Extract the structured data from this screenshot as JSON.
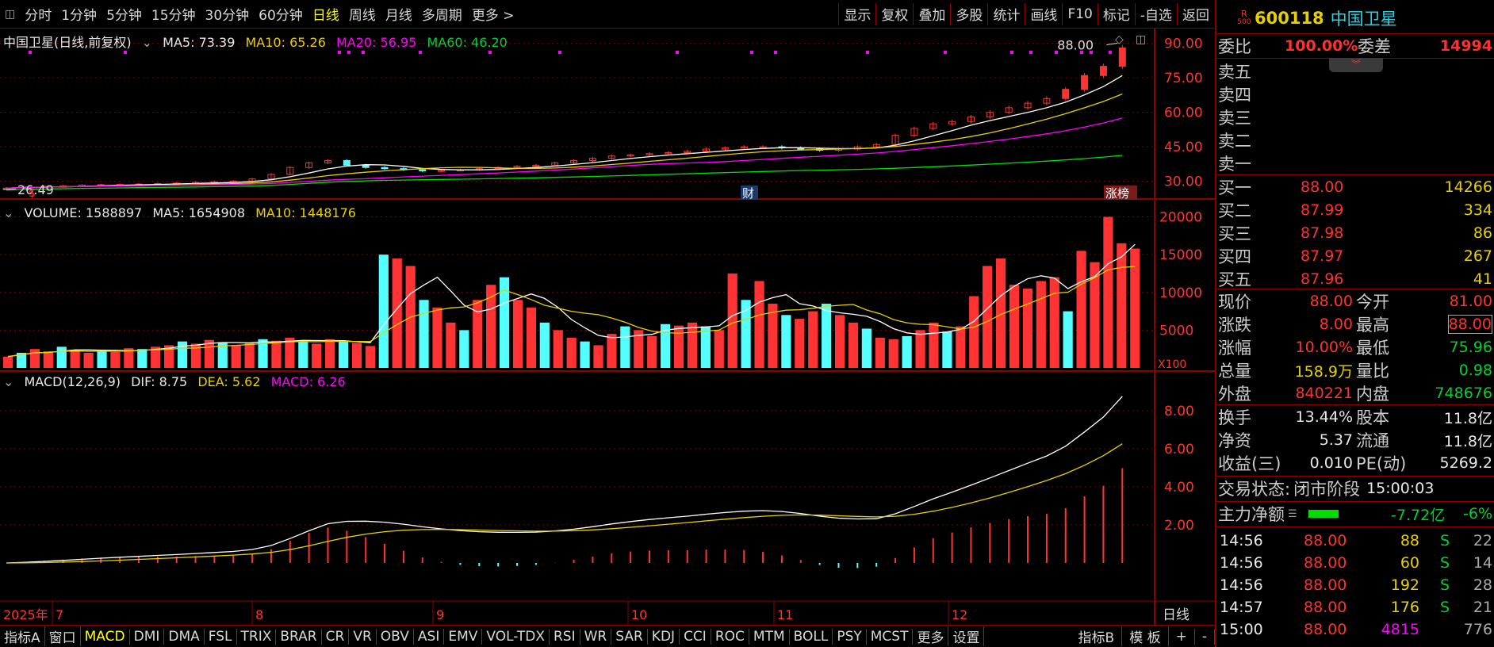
{
  "top_toolbar": {
    "left_items": [
      "分时",
      "1分钟",
      "5分钟",
      "15分钟",
      "30分钟",
      "60分钟",
      "日线",
      "周线",
      "月线",
      "多周期",
      "更多 >"
    ],
    "active": "日线",
    "right_items": [
      "显示",
      "复权",
      "叠加",
      "多股",
      "统计",
      "画线",
      "F10",
      "标记",
      "-自选",
      "返回"
    ]
  },
  "kline": {
    "title": "中国卫星(日线,前复权)",
    "ma5": "MA5: 73.39",
    "ma10": "MA10: 65.26",
    "ma20": "MA20: 56.95",
    "ma60": "MA60: 46.20",
    "price_ticks": [
      "90.00",
      "75.00",
      "60.00",
      "45.00",
      "30.00"
    ],
    "high_label": "88.00",
    "low_label": "26.49",
    "marker_cai": "财",
    "marker_zhangbang": "涨榜"
  },
  "volume": {
    "title": "VOLUME: 1588897",
    "ma5": "MA5: 1654908",
    "ma10": "MA10: 1448176",
    "ticks": [
      "20000",
      "15000",
      "10000",
      "5000"
    ],
    "unit": "X100"
  },
  "macd": {
    "title": "MACD(12,26,9)",
    "dif": "DIF: 8.75",
    "dea": "DEA: 5.62",
    "macd": "MACD: 6.26",
    "ticks": [
      "8.00",
      "6.00",
      "4.00",
      "2.00"
    ]
  },
  "time_axis": {
    "labels": [
      "2025年",
      "7",
      "8",
      "9",
      "10",
      "11",
      "12"
    ],
    "period": "日线"
  },
  "colors": {
    "up": "#ff3333",
    "down": "#54ffff",
    "ma5": "#ffffff",
    "ma10": "#e8d000",
    "ma20": "#ff00ff",
    "ma60": "#00e000",
    "frame": "#8b0000"
  },
  "chart_data": [
    {
      "type": "candlestick",
      "title": "中国卫星(日线,前复权)",
      "y_range": [
        24,
        93
      ],
      "x_labels": [
        "7",
        "8",
        "9",
        "10",
        "11",
        "12"
      ],
      "close_approx": [
        27,
        27.5,
        27.8,
        28,
        28.3,
        28.5,
        28.6,
        28.8,
        29,
        29.2,
        29.5,
        29.8,
        30,
        31,
        33,
        36,
        38,
        39,
        37,
        36,
        35.5,
        35,
        34.5,
        34.8,
        35,
        35.5,
        36,
        36.5,
        37,
        38,
        39,
        40,
        41,
        41.5,
        42,
        42.5,
        43,
        44,
        44.5,
        45,
        45,
        44.5,
        44,
        43.5,
        44,
        45,
        46,
        50,
        53,
        55,
        56,
        58,
        60,
        62,
        64,
        66,
        70,
        76,
        80,
        88
      ],
      "series": [
        {
          "name": "MA5",
          "last": 73.39
        },
        {
          "name": "MA10",
          "last": 65.26
        },
        {
          "name": "MA20",
          "last": 56.95
        },
        {
          "name": "MA60",
          "last": 46.2
        }
      ]
    },
    {
      "type": "bar",
      "title": "VOLUME",
      "unit": "X100",
      "y_range": [
        0,
        21000
      ],
      "values": [
        1500,
        2000,
        2500,
        2200,
        2800,
        2400,
        2000,
        2300,
        2100,
        2600,
        2500,
        2800,
        3000,
        3500,
        3200,
        3700,
        3400,
        3000,
        3300,
        3800,
        3600,
        4000,
        3500,
        3200,
        3800,
        3500,
        3300,
        2900,
        15000,
        14500,
        13500,
        9000,
        8000,
        6000,
        5000,
        9000,
        11000,
        12000,
        9000,
        8000,
        6000,
        5000,
        4000,
        3500,
        3000,
        4500,
        5500,
        5000,
        4200,
        5800,
        5600,
        6000,
        5500,
        5000,
        12500,
        9000,
        11500,
        8500,
        7000,
        6500,
        7500,
        8500,
        7000,
        6000,
        5200,
        4000,
        3800,
        4200,
        5000,
        6000,
        4800,
        5500,
        9500,
        13500,
        14500,
        11000,
        10500,
        11500,
        12000,
        7500,
        15500,
        14000,
        20000,
        16500,
        15800
      ],
      "series": [
        {
          "name": "MA5",
          "last": 1654908
        },
        {
          "name": "MA10",
          "last": 1448176
        }
      ]
    },
    {
      "type": "line",
      "title": "MACD(12,26,9)",
      "y_range": [
        -1.5,
        9.5
      ],
      "series": [
        {
          "name": "DIF",
          "last": 8.75
        },
        {
          "name": "DEA",
          "last": 5.62
        },
        {
          "name": "MACD",
          "last": 6.26
        }
      ]
    }
  ],
  "quote": {
    "code": "600118",
    "name": "中国卫星",
    "badge_top": "R",
    "badge_bottom": "500",
    "weibi_label": "委比",
    "weibi_value": "100.00%",
    "weicha_label": "委差",
    "weicha_value": "14994",
    "sell": [
      {
        "label": "卖五",
        "price": "",
        "vol": ""
      },
      {
        "label": "卖四",
        "price": "",
        "vol": ""
      },
      {
        "label": "卖三",
        "price": "",
        "vol": ""
      },
      {
        "label": "卖二",
        "price": "",
        "vol": ""
      },
      {
        "label": "卖一",
        "price": "",
        "vol": ""
      }
    ],
    "buy": [
      {
        "label": "买一",
        "price": "88.00",
        "vol": "14266"
      },
      {
        "label": "买二",
        "price": "87.99",
        "vol": "334"
      },
      {
        "label": "买三",
        "price": "87.98",
        "vol": "86"
      },
      {
        "label": "买四",
        "price": "87.97",
        "vol": "267"
      },
      {
        "label": "买五",
        "price": "87.96",
        "vol": "41"
      }
    ],
    "stats": [
      {
        "l1": "现价",
        "v1": "88.00",
        "c1": "red",
        "l2": "今开",
        "v2": "81.00",
        "c2": "red"
      },
      {
        "l1": "涨跌",
        "v1": "8.00",
        "c1": "red",
        "l2": "最高",
        "v2": "88.00",
        "c2": "red"
      },
      {
        "l1": "涨幅",
        "v1": "10.00%",
        "c1": "red",
        "l2": "最低",
        "v2": "75.96",
        "c2": "grn"
      },
      {
        "l1": "总量",
        "v1": "158.9万",
        "c1": "yel",
        "l2": "量比",
        "v2": "0.98",
        "c2": "grn"
      },
      {
        "l1": "外盘",
        "v1": "840221",
        "c1": "red",
        "l2": "内盘",
        "v2": "748676",
        "c2": "grn"
      }
    ],
    "stats2": [
      {
        "l1": "换手",
        "v1": "13.44%",
        "l2": "股本",
        "v2": "11.8亿"
      },
      {
        "l1": "净资",
        "v1": "5.37",
        "l2": "流通",
        "v2": "11.8亿"
      },
      {
        "l1": "收益(三)",
        "v1": "0.010",
        "l2": "PE(动)",
        "v2": "5269.2"
      }
    ],
    "trade_status_label": "交易状态:",
    "trade_status_value": "闭市阶段",
    "trade_status_time": "15:00:03",
    "mainflow_label": "主力净额",
    "mainflow_value": "-7.72亿",
    "mainflow_pct": "-6%",
    "ticks": [
      {
        "time": "14:56",
        "price": "88.00",
        "vol": "88",
        "side": "S",
        "n": "22"
      },
      {
        "time": "14:56",
        "price": "88.00",
        "vol": "60",
        "side": "S",
        "n": "14"
      },
      {
        "time": "14:56",
        "price": "88.00",
        "vol": "192",
        "side": "S",
        "n": "28"
      },
      {
        "time": "14:57",
        "price": "88.00",
        "vol": "176",
        "side": "S",
        "n": "21"
      },
      {
        "time": "15:00",
        "price": "88.00",
        "vol": "4815",
        "side": "",
        "n": "776"
      }
    ]
  },
  "bottom_tabs": {
    "items": [
      "指标A",
      "窗口",
      "MACD",
      "DMI",
      "DMA",
      "FSL",
      "TRIX",
      "BRAR",
      "CR",
      "VR",
      "OBV",
      "ASI",
      "EMV",
      "VOL-TDX",
      "RSI",
      "WR",
      "SAR",
      "KDJ",
      "CCI",
      "ROC",
      "MTM",
      "BOLL",
      "PSY",
      "MCST",
      "更多",
      "设置"
    ],
    "active": "MACD",
    "right_items": [
      "指标B",
      "模 板",
      "+",
      "-"
    ]
  }
}
